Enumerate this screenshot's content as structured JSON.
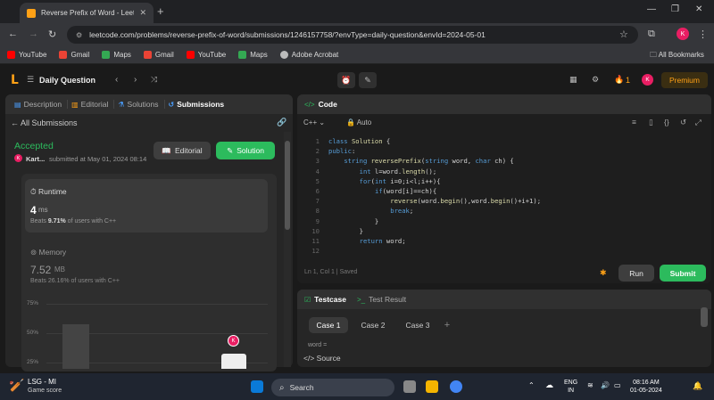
{
  "browser": {
    "tab_title": "Reverse Prefix of Word - LeetC",
    "url": "leetcode.com/problems/reverse-prefix-of-word/submissions/1246157758/?envType=daily-question&envId=2024-05-01",
    "profile_initial": "K",
    "bookmarks": [
      {
        "label": "YouTube",
        "color": "#ff0000"
      },
      {
        "label": "Gmail",
        "color": "#ea4335"
      },
      {
        "label": "Maps",
        "color": "#34a853"
      },
      {
        "label": "Gmail",
        "color": "#ea4335"
      },
      {
        "label": "YouTube",
        "color": "#ff0000"
      },
      {
        "label": "Maps",
        "color": "#34a853"
      },
      {
        "label": "Adobe Acrobat",
        "color": "#bbbbbb"
      }
    ],
    "all_bookmarks": "All Bookmarks"
  },
  "leetcode": {
    "daily_question": "Daily Question",
    "streak": "1",
    "avatar_initial": "K",
    "premium": "Premium"
  },
  "left": {
    "tabs": [
      {
        "label": "Description",
        "icon": "description-icon"
      },
      {
        "label": "Editorial",
        "icon": "editorial-icon"
      },
      {
        "label": "Solutions",
        "icon": "flask-icon"
      },
      {
        "label": "Submissions",
        "icon": "history-icon"
      }
    ],
    "all_submissions": "All Submissions",
    "status": "Accepted",
    "user": "Kart...",
    "submitted": "submitted at May 01, 2024 08:14",
    "editorial_btn": "Editorial",
    "solution_btn": "Solution",
    "runtime": {
      "label": "Runtime",
      "value": "4",
      "unit": "ms",
      "beats_pre": "Beats",
      "beats_pct": "9.71%",
      "beats_post": "of users with C++"
    },
    "memory": {
      "label": "Memory",
      "value": "7.52",
      "unit": "MB",
      "beats": "Beats 26.16% of users with C++"
    },
    "chart_ticks": [
      "75%",
      "50%",
      "25%"
    ],
    "you_marker": "K"
  },
  "code": {
    "header": "Code",
    "language": "C++",
    "auto": "Auto",
    "line_numbers": [
      "1",
      "2",
      "3",
      "4",
      "5",
      "6",
      "7",
      "8",
      "9",
      "10",
      "11",
      "12"
    ],
    "lines": [
      "class Solution {",
      "public:",
      "    string reversePrefix(string word, char ch) {",
      "        int l=word.length();",
      "        for(int i=0;i<l;i++){",
      "            if(word[i]==ch){",
      "                reverse(word.begin(),word.begin()+i+1);",
      "                break;",
      "            }",
      "        }",
      "        return word;",
      ""
    ],
    "status": "Ln 1, Col 1  |  Saved",
    "run": "Run",
    "submit": "Submit"
  },
  "testcase": {
    "tabs": [
      "Testcase",
      "Test Result"
    ],
    "cases": [
      "Case 1",
      "Case 2",
      "Case 3"
    ],
    "add": "+",
    "word_label": "word =",
    "source": "Source"
  },
  "taskbar": {
    "app_name": "LSG - MI",
    "app_sub": "Game score",
    "search": "Search",
    "lang_top": "ENG",
    "lang_bottom": "IN",
    "time": "08:16 AM",
    "date": "01-05-2024"
  }
}
